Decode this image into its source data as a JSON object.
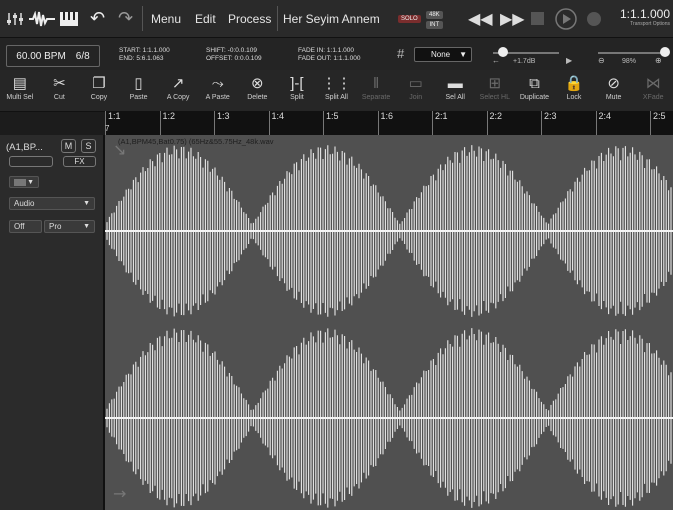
{
  "topbar": {
    "menu": "Menu",
    "edit": "Edit",
    "process": "Process",
    "project_title": "Her Seyim Annem",
    "solo_label": "SOLO",
    "rate_label": "48K",
    "int_label": "INT",
    "position": "1:1.1.000",
    "transport_options": "Transport Options"
  },
  "infobar": {
    "bpm": "60.00 BPM",
    "meter": "6/8",
    "start": "START: 1:1.1.000",
    "end": "END: 5:6.1.063",
    "shift": "SHIFT: -0:0.0.109",
    "offset": "OFFSET: 0:0.0.109",
    "fade_in": "FADE IN: 1:1.1.000",
    "fade_out": "FADE OUT: 1:1.1.000",
    "snap": "None",
    "gain": "+1.7dB",
    "zoom": "98%"
  },
  "toolbar": {
    "items": [
      {
        "label": "Multi Sel",
        "icon": "multi-select-icon"
      },
      {
        "label": "Cut",
        "icon": "scissors-icon"
      },
      {
        "label": "Copy",
        "icon": "copy-icon"
      },
      {
        "label": "Paste",
        "icon": "clipboard-icon"
      },
      {
        "label": "A Copy",
        "icon": "automation-copy-icon"
      },
      {
        "label": "A Paste",
        "icon": "automation-paste-icon"
      },
      {
        "label": "Delete",
        "icon": "delete-icon"
      },
      {
        "label": "Split",
        "icon": "split-icon"
      },
      {
        "label": "Split All",
        "icon": "split-all-icon"
      },
      {
        "label": "Separate",
        "icon": "separate-icon"
      },
      {
        "label": "Join",
        "icon": "join-icon"
      },
      {
        "label": "Sel All",
        "icon": "select-all-icon"
      },
      {
        "label": "Select HL",
        "icon": "select-highlight-icon"
      },
      {
        "label": "Duplicate",
        "icon": "duplicate-icon"
      },
      {
        "label": "Lock",
        "icon": "lock-icon"
      },
      {
        "label": "Mute",
        "icon": "mute-icon"
      },
      {
        "label": "XFade",
        "icon": "crossfade-icon"
      }
    ]
  },
  "ruler": {
    "marks": [
      "1:1",
      "1:2",
      "1:3",
      "1:4",
      "1:5",
      "1:6",
      "2:1",
      "2:2",
      "2:3",
      "2:4",
      "2:5"
    ],
    "sub": "7"
  },
  "track": {
    "name": "(A1,BP...",
    "mute": "M",
    "solo": "S",
    "fx": "FX",
    "type": "Audio",
    "auto_mode": "Off",
    "auto_param": "Pro",
    "region_label": "(A1,BPM45,Bat0.75) (65Hz&55.75Hz_48k.wav"
  },
  "colors": {
    "wave_bg": "#505050",
    "wave_fg": "#e8e8e8"
  }
}
